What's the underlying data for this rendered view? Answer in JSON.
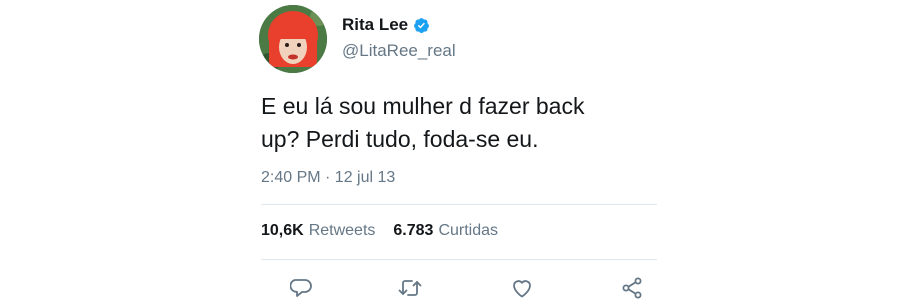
{
  "user": {
    "display_name": "Rita Lee",
    "handle": "@LitaRee_real",
    "verified": true,
    "avatar_icon": "profile-avatar"
  },
  "tweet": {
    "text": "E eu lá sou mulher d fazer back\nup? Perdi tudo, foda-se eu.",
    "timestamp": "2:40 PM · 12 jul 13"
  },
  "stats": {
    "retweets_count": "10,6K",
    "retweets_label": "Retweets",
    "likes_count": "6.783",
    "likes_label": "Curtidas"
  },
  "actions": [
    {
      "name": "reply",
      "icon": "speech-bubble-icon"
    },
    {
      "name": "retweet",
      "icon": "retweet-icon"
    },
    {
      "name": "like",
      "icon": "heart-icon"
    },
    {
      "name": "share",
      "icon": "share-icon"
    }
  ],
  "colors": {
    "text": "#14171a",
    "secondary": "#657786",
    "verified": "#1da1f2",
    "divider": "#e1e8ed"
  }
}
